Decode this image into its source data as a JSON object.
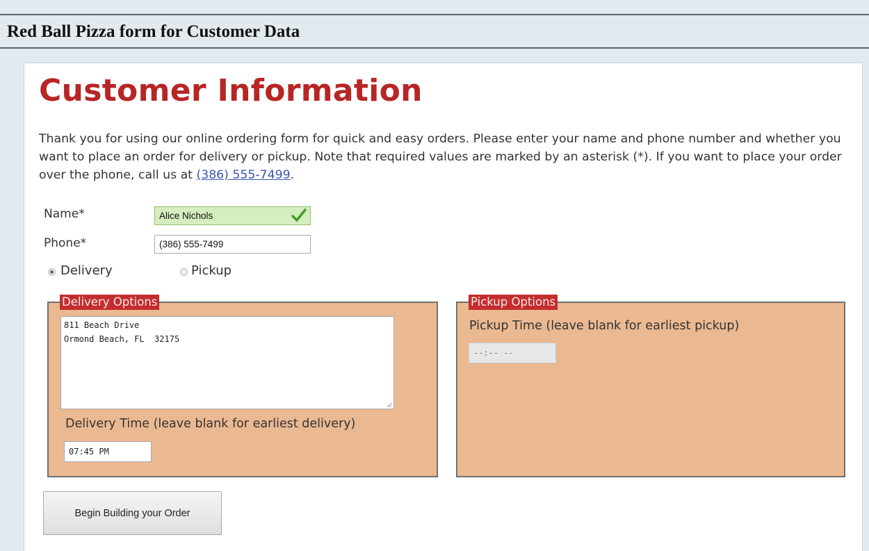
{
  "caption": {
    "title": "Red Ball Pizza form for Customer Data"
  },
  "form": {
    "heading": "Customer Information",
    "intro_text": "Thank you for using our online ordering form for quick and easy orders. Please enter your name and phone number and whether you want to place an order for delivery or pickup. Note that required values are marked by an asterisk (*). If you want to place your order over the phone, call us at ",
    "phone_link": "(386) 555-7499",
    "intro_end": ".",
    "name_label": "Name*",
    "name_value": "Alice Nichols",
    "name_valid": true,
    "phone_label": "Phone*",
    "phone_value": "(386) 555-7499",
    "order_type": {
      "options": [
        "Delivery",
        "Pickup"
      ],
      "selected": "Delivery"
    },
    "delivery": {
      "legend": "Delivery Options",
      "address": "811 Beach Drive\nOrmond Beach, FL  32175",
      "time_label": "Delivery Time (leave blank for earliest delivery)",
      "time_value": "07:45 PM"
    },
    "pickup": {
      "legend": "Pickup Options",
      "time_label": "Pickup Time (leave blank for earliest pickup)",
      "time_placeholder": "--:-- --",
      "disabled": true
    },
    "submit_label": "Begin Building your Order"
  },
  "colors": {
    "heading_red": "#b82525",
    "legend_red": "#c42d2d",
    "fieldset_bg": "#ebb991",
    "valid_green": "#d4eec0",
    "link_blue": "#3a56b0"
  },
  "icons": {
    "valid": "check-icon"
  }
}
